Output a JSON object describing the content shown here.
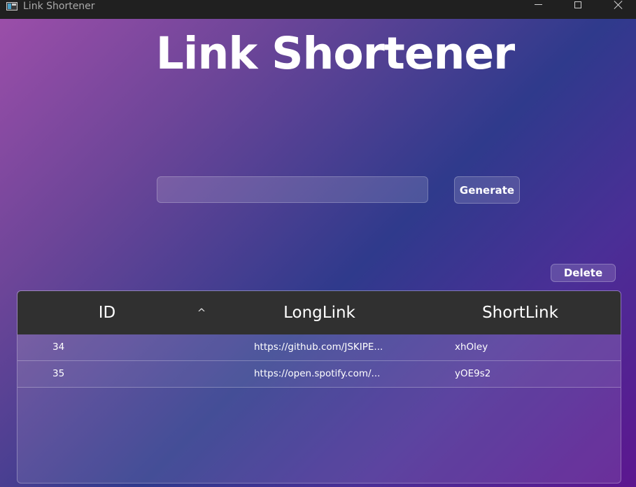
{
  "window": {
    "title": "Link Shortener"
  },
  "app": {
    "heading": "Link Shortener"
  },
  "form": {
    "url_value": "",
    "url_placeholder": "",
    "generate_label": "Generate"
  },
  "actions": {
    "delete_label": "Delete"
  },
  "table": {
    "columns": [
      "ID",
      "LongLink",
      "ShortLink"
    ],
    "sort_indicator": "^",
    "rows": [
      {
        "id": "34",
        "long": "https://github.com/JSKIPE...",
        "short": "xhOley"
      },
      {
        "id": "35",
        "long": "https://open.spotify.com/...",
        "short": "yOE9s2"
      }
    ]
  },
  "colors": {
    "titlebar": "#202020",
    "table_header": "#303030",
    "gradient_start": "#9b4ea9",
    "gradient_end": "#5c168f",
    "text": "#ffffff"
  }
}
